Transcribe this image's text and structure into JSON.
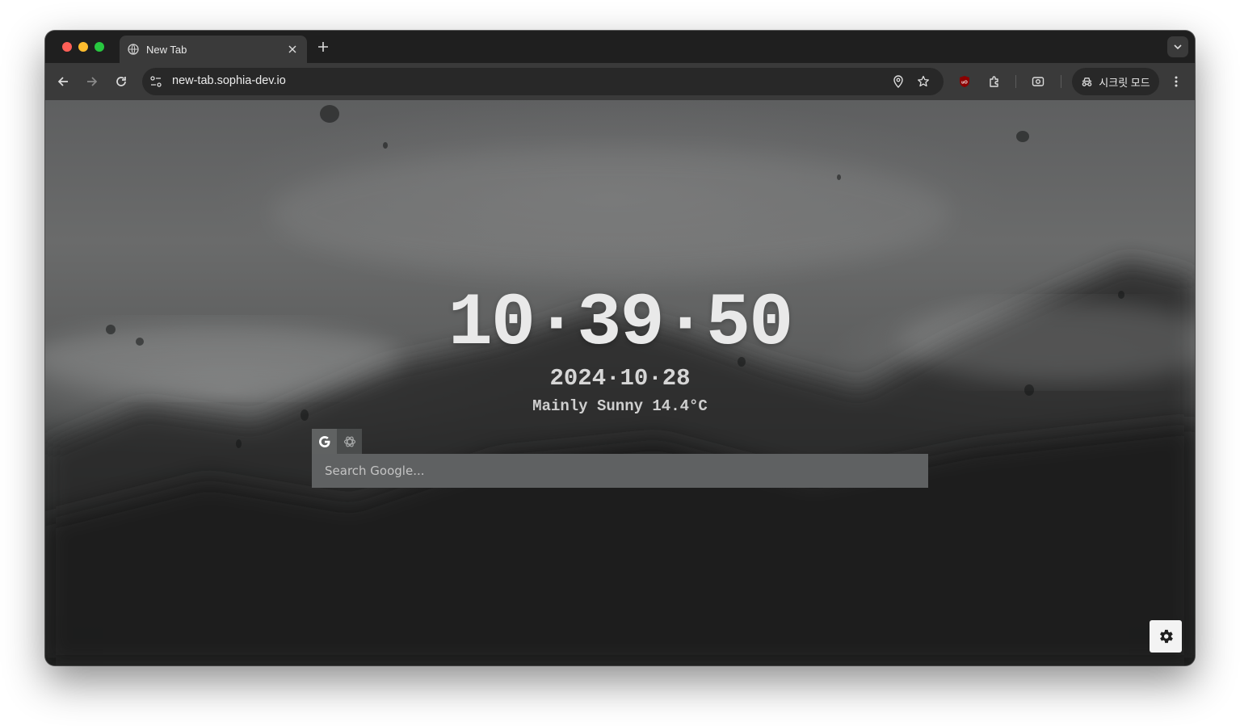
{
  "browser": {
    "tab": {
      "title": "New Tab"
    },
    "address_bar": {
      "url": "new-tab.sophia-dev.io"
    },
    "incognito_label": "시크릿 모드"
  },
  "page": {
    "clock": "10·39·50",
    "date": "2024·10·28",
    "weather": "Mainly Sunny 14.4°C",
    "search": {
      "placeholder": "Search Google...",
      "value": "",
      "engines": [
        {
          "name": "google-icon",
          "active": true
        },
        {
          "name": "chatgpt-icon",
          "active": false
        }
      ]
    }
  },
  "colors": {
    "tab_bar": "#1f1f1f",
    "toolbar": "#3a3a3a",
    "omnibox": "#282828",
    "search_box": "#5f6162"
  }
}
